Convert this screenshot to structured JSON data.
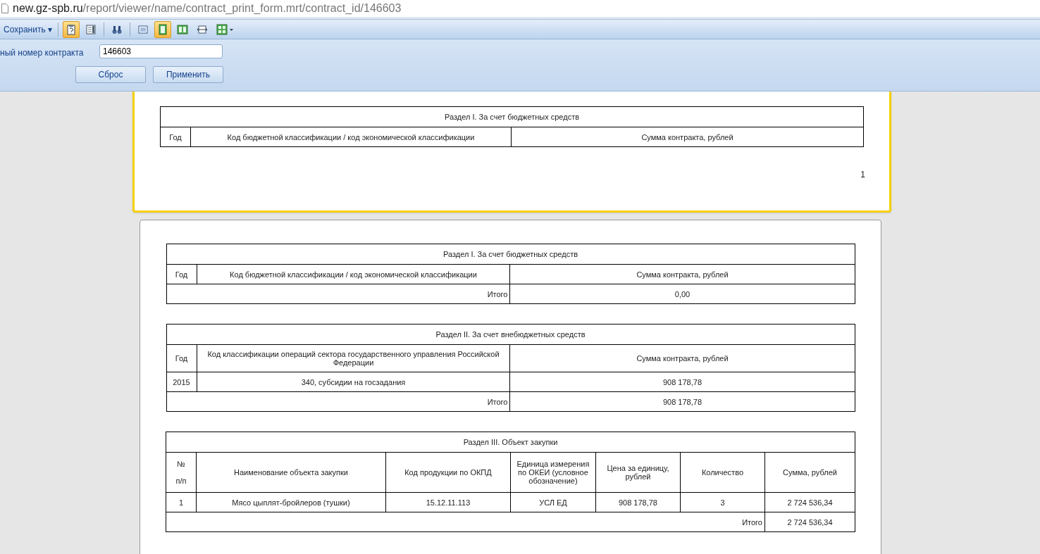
{
  "address_bar": {
    "host": "new.gz-spb.ru",
    "path": "/report/viewer/name/contract_print_form.mrt/contract_id/146603"
  },
  "toolbar": {
    "save_button": "Сохранить ▾",
    "icons": [
      {
        "kind": "help",
        "selected": true
      },
      {
        "kind": "sidebar",
        "selected": false
      },
      {
        "kind": "find",
        "selected": false
      },
      {
        "kind": "one",
        "selected": false
      },
      {
        "kind": "page",
        "selected": true
      },
      {
        "kind": "two",
        "selected": false
      },
      {
        "kind": "width",
        "selected": false
      },
      {
        "kind": "multi",
        "selected": false
      }
    ]
  },
  "parameters": {
    "label": "ный номер контракта",
    "value": "146603",
    "buttons": [
      "Сброс",
      "Применить"
    ]
  },
  "pages": [
    {
      "cut": true,
      "page_number": "1",
      "tables": [
        {
          "kind": "budget",
          "title": "Раздел I. За счет бюджетных средств",
          "header": [
            "Год",
            "Код бюджетной классификации / код экономической классификации",
            "Сумма контракта, рублей"
          ]
        }
      ]
    },
    {
      "cut": false,
      "tables": [
        {
          "kind": "budget",
          "title": "Раздел I. За счет бюджетных средств",
          "header": [
            "Год",
            "Код бюджетной классификации / код экономической классификации",
            "Сумма контракта, рублей"
          ],
          "total": {
            "label": "Итого",
            "values": [
              "0,00"
            ]
          }
        },
        {
          "kind": "budget",
          "title": "Раздел II. За счет внебюджетных средств",
          "header": [
            "Год",
            "Код классификации операций сектора государственного управления Российской Федерации",
            "Сумма контракта, рублей"
          ],
          "rows": [
            [
              "2015",
              "340, субсидии на госзадания",
              "908 178,78"
            ]
          ],
          "total": {
            "label": "Итого",
            "values": [
              "908 178,78"
            ]
          }
        },
        {
          "kind": "items",
          "title": "Раздел III. Объект закупки",
          "header": [
            "№\n\nп/п",
            "Наименование объекта закупки",
            "Код продукции по ОКПД",
            "Единица измерения по ОКЕИ (условное обозначение)",
            "Цена за единицу, рублей",
            "Количество",
            "Сумма, рублей"
          ],
          "rows": [
            [
              "1",
              "Мясо  цыплят-бройлеров (тушки)",
              "15.12.11.113",
              "УСЛ ЕД",
              "908 178,78",
              "3",
              "2 724 536,34"
            ]
          ],
          "total": {
            "label": "Итого",
            "values": [
              "2 724 536,34"
            ]
          }
        }
      ]
    }
  ]
}
